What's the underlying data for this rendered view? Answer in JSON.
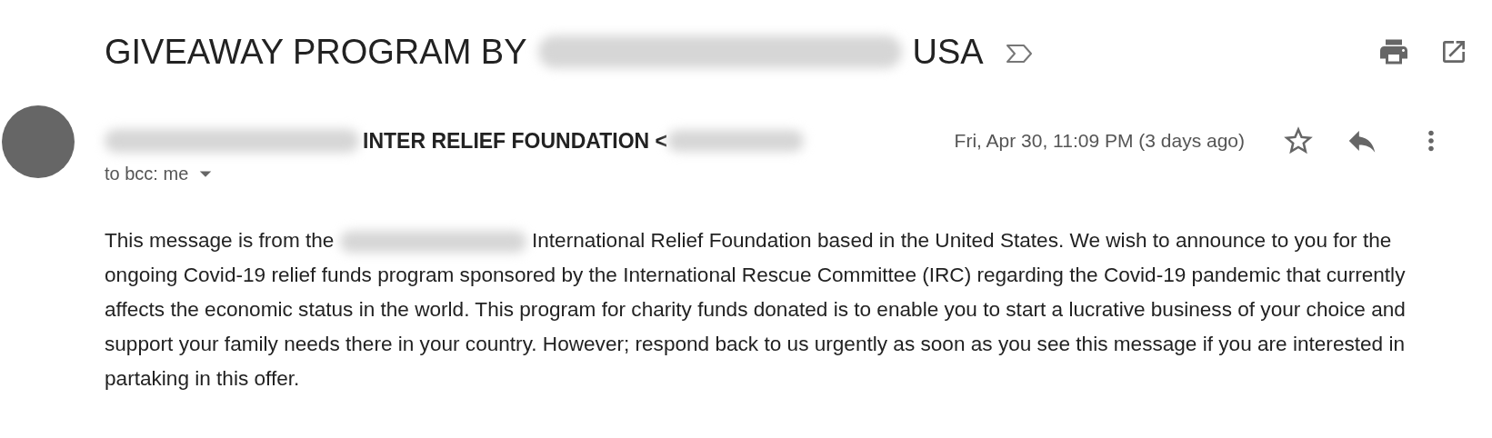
{
  "subject": {
    "before_redaction": "GIVEAWAY PROGRAM BY",
    "after_redaction": "USA"
  },
  "sender": {
    "name_visible": "INTER RELIEF FOUNDATION <",
    "recipient": "to bcc: me",
    "date": "Fri, Apr 30, 11:09 PM (3 days ago)",
    "starred": false
  },
  "body": {
    "before_redaction": "This message is from the",
    "after_redaction": "International Relief Foundation based in the United States. We wish to announce to you for the ongoing Covid-19 relief funds program sponsored by the International Rescue Committee (IRC) regarding the Covid-19 pandemic that currently affects the economic status in the world. This program for charity funds donated is to enable you to start a lucrative business of your choice and support your family needs there in your country. However; respond back to us urgently as soon as you see this message if you are interested in partaking in this offer."
  }
}
